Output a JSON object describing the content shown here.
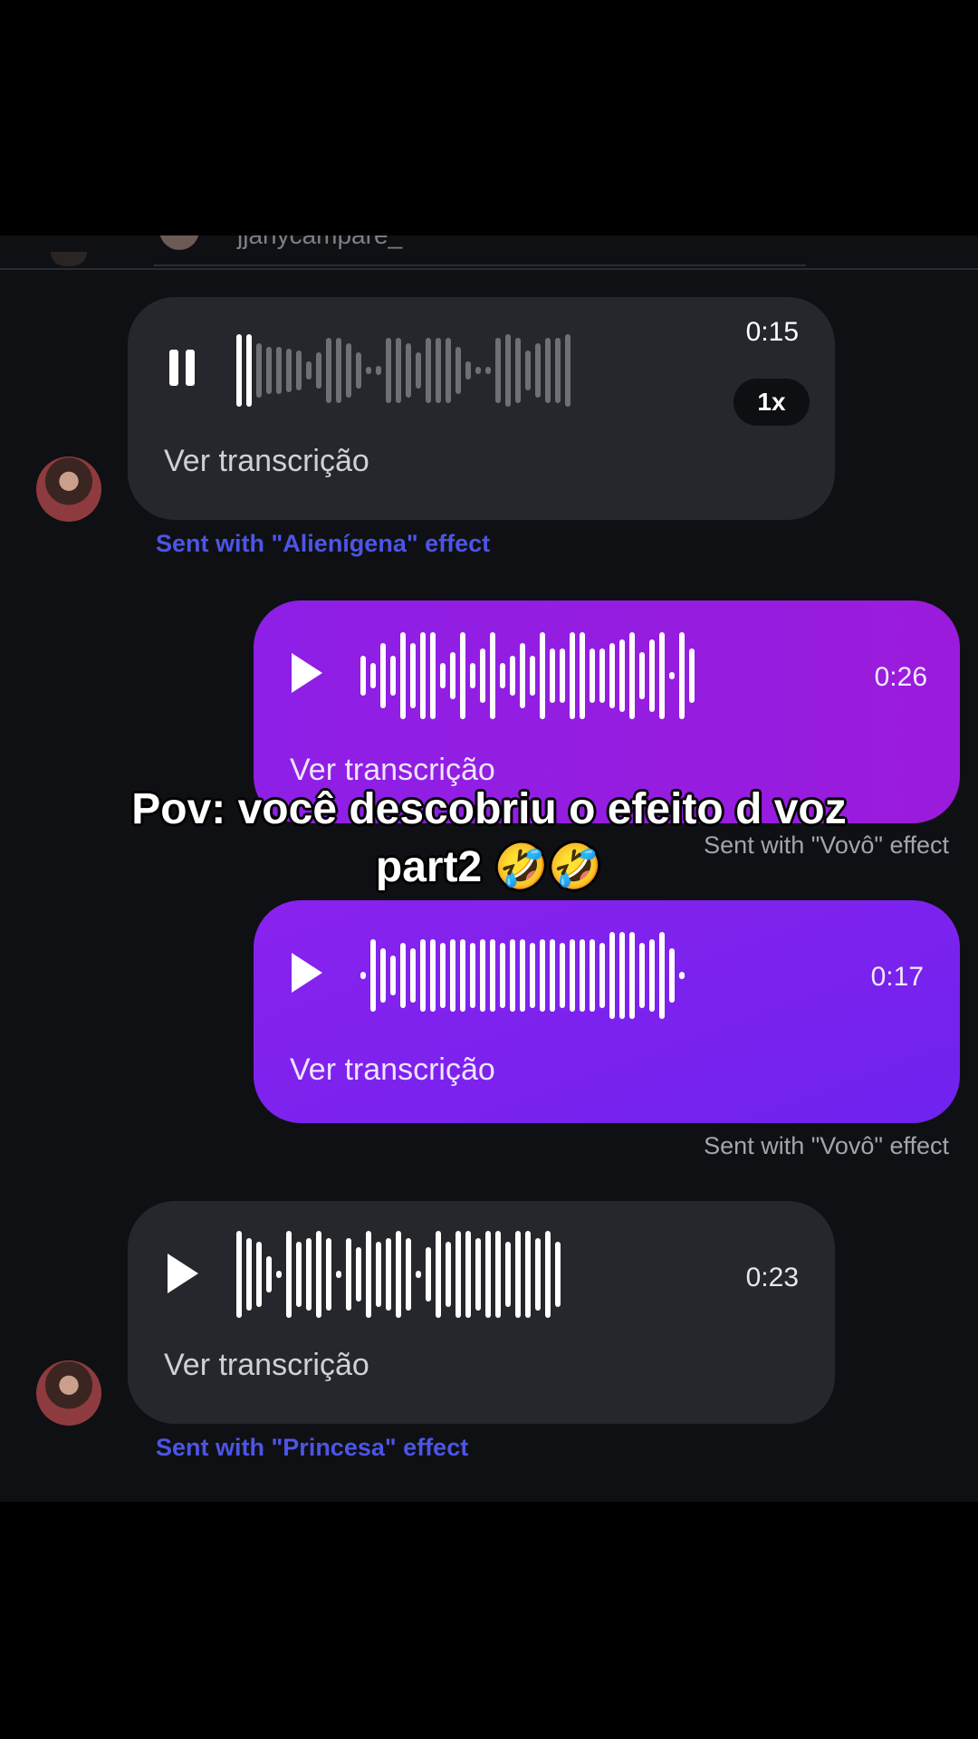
{
  "top_partial": {
    "username": "jjanycampare_"
  },
  "messages": [
    {
      "id": "m1",
      "direction": "incoming",
      "state": "playing",
      "duration": "0:15",
      "speed": "1x",
      "transcript_label": "Ver transcrição",
      "effect_label": "Sent with \"Alienígena\" effect",
      "progress": 0.05
    },
    {
      "id": "m2",
      "direction": "outgoing",
      "state": "paused",
      "duration": "0:26",
      "transcript_label": "Ver transcrição",
      "effect_label": "Sent with \"Vovô\" effect"
    },
    {
      "id": "m3",
      "direction": "outgoing",
      "state": "paused",
      "duration": "0:17",
      "transcript_label": "Ver transcrição",
      "effect_label": "Sent with \"Vovô\" effect"
    },
    {
      "id": "m4",
      "direction": "incoming",
      "state": "paused",
      "duration": "0:23",
      "transcript_label": "Ver transcrição",
      "effect_label": "Sent with \"Princesa\" effect"
    }
  ],
  "caption": {
    "line1": "Pov: você descobriu o efeito d voz",
    "line2": "part2 🤣🤣"
  },
  "colors": {
    "incoming_bubble": "#26272c",
    "outgoing_bubble_1": "#9b1bdc",
    "outgoing_bubble_2": "#7b22ee",
    "effect_link": "#4c55e6"
  },
  "icons": {
    "play": "play-icon",
    "pause": "pause-icon"
  }
}
